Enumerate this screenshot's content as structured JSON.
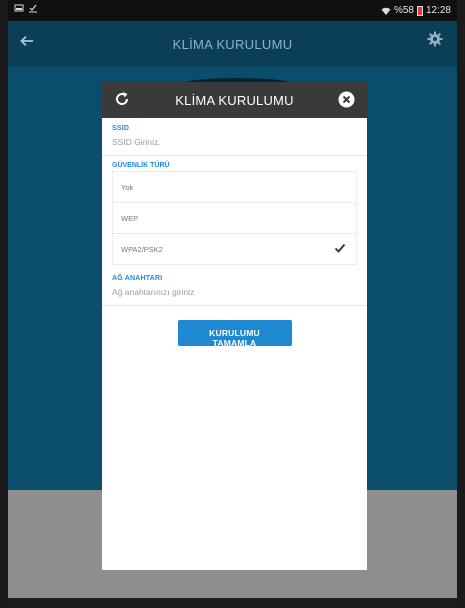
{
  "status_bar": {
    "battery_percent": "%58",
    "time": "12:28"
  },
  "app_bar": {
    "title": "KLİMA KURULUMU"
  },
  "dialog": {
    "title": "KLİMA KURULUMU",
    "ssid": {
      "label": "SSID",
      "placeholder": "SSID Giriniz."
    },
    "security": {
      "label": "GÜVENLİK TÜRÜ",
      "options": [
        {
          "label": "Yok",
          "selected": false
        },
        {
          "label": "WEP",
          "selected": false
        },
        {
          "label": "WPA2/PSK2",
          "selected": true
        }
      ]
    },
    "network_key": {
      "label": "AĞ ANAHTARI",
      "placeholder": "Ağ anahtarınızı giriniz"
    },
    "complete_button": "KURULUMU TAMAMLA"
  },
  "colors": {
    "app_bar": "#0b3f57",
    "content": "#0b4d6c",
    "dialog_header": "#3a3a3a",
    "accent": "#1e88d0"
  }
}
